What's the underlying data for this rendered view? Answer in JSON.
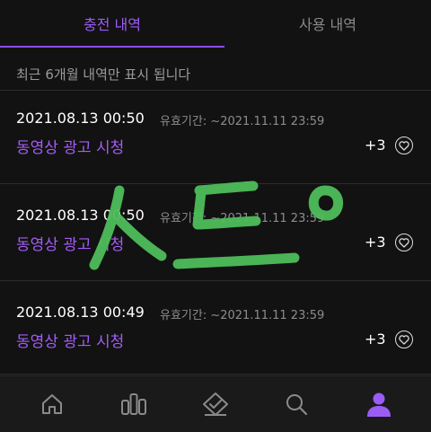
{
  "tabs": [
    {
      "label": "충전 내역",
      "active": true
    },
    {
      "label": "사용 내역",
      "active": false
    }
  ],
  "notice": "최근 6개월 내역만 표시 됩니다",
  "items": [
    {
      "time": "2021.08.13 00:50",
      "expiry": "유효기간: ~2021.11.11 23:59",
      "title": "동영상 광고 시청",
      "amount": "+3"
    },
    {
      "time": "2021.08.13 00:50",
      "expiry": "유효기간: ~2021.11.11 23:59",
      "title": "동영상 광고 시청",
      "amount": "+3"
    },
    {
      "time": "2021.08.13 00:49",
      "expiry": "유효기간: ~2021.11.11 23:59",
      "title": "동영상 광고 시청",
      "amount": "+3"
    }
  ],
  "bottom_nav": [
    {
      "icon": "home-icon",
      "active": false
    },
    {
      "icon": "bar-chart-icon",
      "active": false
    },
    {
      "icon": "ticket-check-icon",
      "active": false
    },
    {
      "icon": "search-icon",
      "active": false
    },
    {
      "icon": "person-icon",
      "active": true
    }
  ],
  "colors": {
    "accent": "#9b5cf6",
    "background": "#121212",
    "handwriting": "#4dbd5a"
  }
}
